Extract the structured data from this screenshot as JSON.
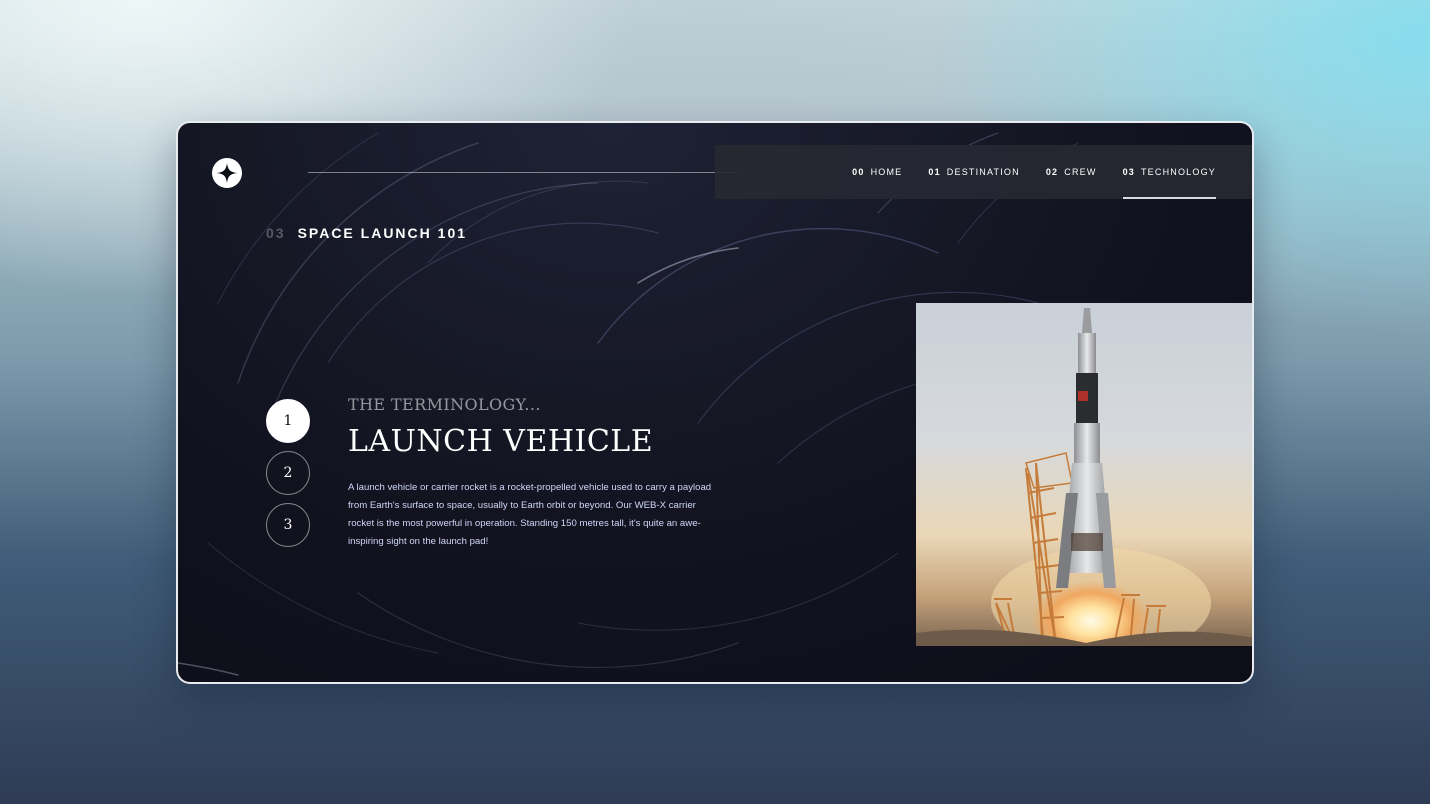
{
  "nav": {
    "items": [
      {
        "num": "00",
        "label": "HOME"
      },
      {
        "num": "01",
        "label": "DESTINATION"
      },
      {
        "num": "02",
        "label": "CREW"
      },
      {
        "num": "03",
        "label": "TECHNOLOGY"
      }
    ],
    "active_index": 3
  },
  "page_heading": {
    "num": "03",
    "label": "SPACE LAUNCH 101"
  },
  "steps": [
    "1",
    "2",
    "3"
  ],
  "active_step": 0,
  "content": {
    "eyebrow": "THE TERMINOLOGY...",
    "title": "LAUNCH VEHICLE",
    "description": "A launch vehicle or carrier rocket is a rocket-propelled vehicle used to carry a payload from Earth's surface to space, usually to Earth orbit or beyond. Our WEB-X carrier rocket is the most powerful in operation. Standing 150 metres tall, it's quite an awe-inspiring sight on the launch pad!"
  },
  "icons": {
    "logo": "star-logo-icon",
    "image": "launch-vehicle-photo"
  },
  "colors": {
    "background_dark": "#0b0d17",
    "text_light": "#d0d6f9",
    "white": "#ffffff"
  }
}
